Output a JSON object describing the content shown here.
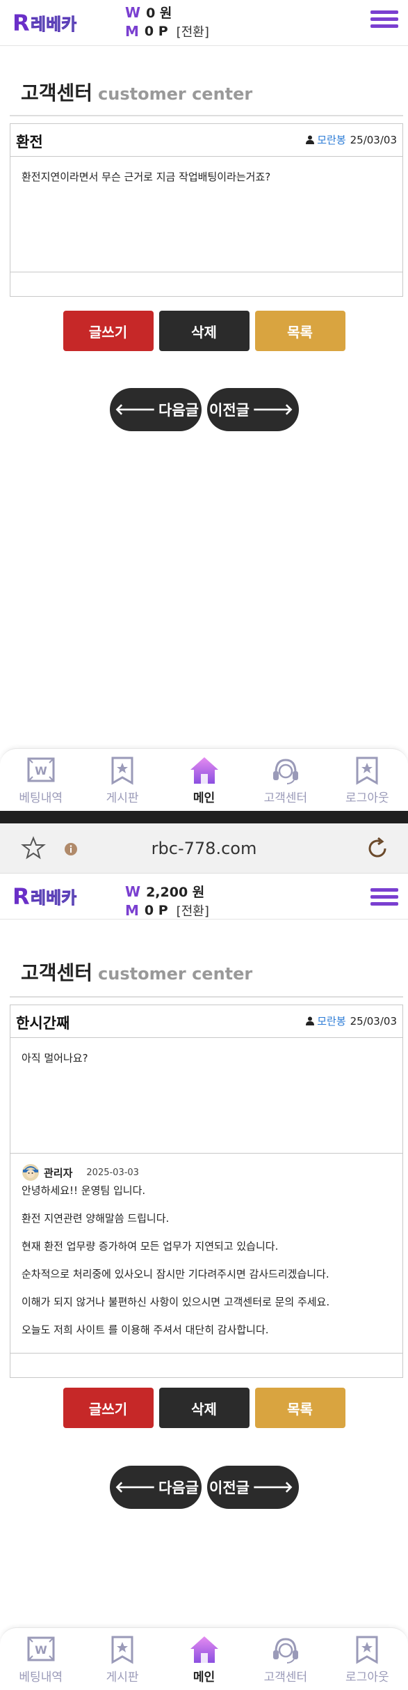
{
  "top": {
    "header": {
      "logo_text": "레베카",
      "w_symbol": "W",
      "w_balance": "0 원",
      "m_symbol": "M",
      "m_balance": "0 P",
      "exchange_label": "[전환]"
    },
    "page_title": "고객센터",
    "page_subtitle": "customer center",
    "post": {
      "subject": "환전",
      "author": "모란봉",
      "date": "25/03/03",
      "body": "환전지연이라면서 무슨 근거로 지금 작업배팅이라는거죠?"
    },
    "buttons": {
      "write": "글쓰기",
      "delete": "삭제",
      "list": "목록"
    },
    "nav": {
      "next": "다음글",
      "prev": "이전글"
    }
  },
  "bottom_nav": [
    {
      "label": "베팅내역",
      "icon": "betting-history-icon"
    },
    {
      "label": "게시판",
      "icon": "board-icon"
    },
    {
      "label": "메인",
      "icon": "home-icon"
    },
    {
      "label": "고객센터",
      "icon": "headset-icon"
    },
    {
      "label": "로그아웃",
      "icon": "logout-icon"
    }
  ],
  "browser": {
    "url": "rbc-778.com"
  },
  "second": {
    "header": {
      "logo_text": "레베카",
      "w_symbol": "W",
      "w_balance": "2,200 원",
      "m_symbol": "M",
      "m_balance": "0 P",
      "exchange_label": "[전환]"
    },
    "page_title": "고객센터",
    "page_subtitle": "customer center",
    "post": {
      "subject": "한시간째",
      "author": "모란봉",
      "date": "25/03/03",
      "body": "아직 멀어나요?"
    },
    "reply": {
      "name": "관리자",
      "date": "2025-03-03",
      "lines": [
        "안녕하세요!! 운영팀 입니다.",
        "환전 지연관련 양해말씀 드립니다.",
        "현재 환전 업무량 증가하여 모든 업무가 지연되고 있습니다.",
        "순차적으로 처리중에 있사오니 잠시만 기다려주시면 감사드리겠습니다.",
        "이해가 되지 않거나 불편하신 사항이 있으시면 고객센터로 문의 주세요.",
        "오늘도 저희 사이트 를 이용해 주셔서 대단히 감사합니다."
      ]
    },
    "buttons": {
      "write": "글쓰기",
      "delete": "삭제",
      "list": "목록"
    },
    "nav": {
      "next": "다음글",
      "prev": "이전글"
    }
  },
  "colors": {
    "accent_purple": "#7a3fd0",
    "write_red": "#c62828",
    "delete_dark": "#2b2b2b",
    "list_gold": "#d9a440",
    "author_blue": "#2b7bd6"
  }
}
